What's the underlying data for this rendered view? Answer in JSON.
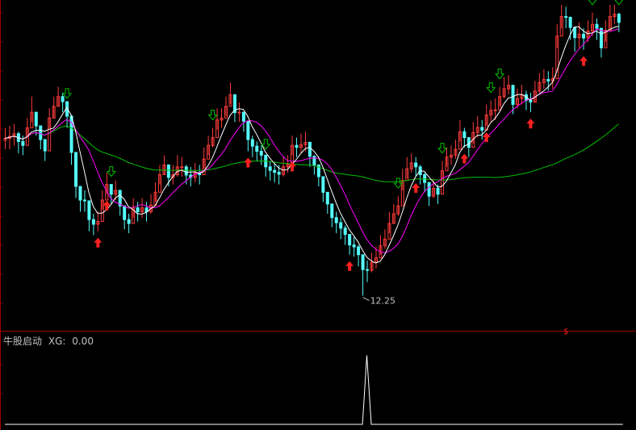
{
  "colors": {
    "up_candle": "#ff3b3b",
    "down_candle": "#54fcfc",
    "ma_short": "#ffffff",
    "ma_mid": "#ff00ff",
    "ma_long": "#00c000",
    "buy_arrow": "#ff2020",
    "sell_arrow": "#00c000",
    "axis": "#a00000",
    "grid_tick": "#800000",
    "indicator_line": "#ffffff"
  },
  "icons": {
    "buy": "red-up-arrow-icon",
    "sell": "green-down-arrow-icon"
  },
  "sub_panel": {
    "name": "牛股启动",
    "indicator": "XG:",
    "value": "0.00"
  },
  "chart_data": [
    {
      "type": "candlestick",
      "low_label": "12.25",
      "ylim": [
        11.6,
        19.7
      ],
      "closes": [
        16.28,
        16.33,
        16.4,
        16.2,
        16.1,
        16.55,
        16.95,
        16.6,
        16.25,
        15.96,
        16.8,
        17.1,
        17.35,
        17.22,
        16.85,
        15.92,
        15.05,
        14.7,
        14.68,
        14.2,
        14.08,
        14.15,
        14.7,
        15.1,
        14.85,
        14.95,
        14.55,
        14.2,
        14.1,
        14.5,
        14.4,
        14.5,
        14.4,
        14.57,
        14.9,
        15.35,
        15.6,
        15.28,
        15.35,
        15.55,
        15.55,
        15.34,
        15.28,
        15.4,
        15.35,
        15.75,
        16.1,
        16.3,
        16.75,
        16.8,
        17.1,
        17.4,
        16.94,
        16.95,
        16.72,
        16.25,
        16.08,
        15.95,
        15.85,
        15.55,
        15.46,
        15.41,
        15.36,
        15.55,
        15.62,
        16.1,
        16.05,
        16.12,
        16.18,
        15.82,
        15.6,
        15.3,
        14.9,
        14.6,
        14.25,
        14.12,
        13.98,
        13.82,
        13.55,
        13.5,
        13.3,
        12.92,
        12.9,
        13.1,
        13.22,
        13.53,
        13.7,
        14.1,
        14.35,
        14.55,
        15.2,
        15.5,
        15.65,
        15.55,
        15.35,
        15.15,
        14.8,
        15.0,
        14.85,
        15.45,
        15.8,
        15.85,
        16.0,
        16.45,
        16.3,
        16.05,
        16.43,
        16.56,
        16.49,
        16.88,
        17.0,
        17.01,
        17.35,
        17.55,
        17.64,
        17.15,
        17.3,
        17.4,
        17.25,
        17.21,
        17.49,
        17.71,
        17.79,
        17.75,
        17.81,
        18.9,
        19.4,
        19.38,
        19.12,
        18.86,
        18.95,
        18.85,
        19.03,
        19.2,
        19.1,
        18.6,
        19.05,
        19.4,
        19.46,
        19.25
      ],
      "lows": [
        16.0,
        16.0,
        16.1,
        15.9,
        15.85,
        16.3,
        16.7,
        16.35,
        16.0,
        15.7,
        16.5,
        16.8,
        17.1,
        16.95,
        16.55,
        15.6,
        14.75,
        14.4,
        14.4,
        13.9,
        13.8,
        13.9,
        14.45,
        14.85,
        14.6,
        14.7,
        14.3,
        13.95,
        13.85,
        14.25,
        14.15,
        14.25,
        14.15,
        14.35,
        14.65,
        15.1,
        15.35,
        15.05,
        15.1,
        15.3,
        15.3,
        15.1,
        15.05,
        15.15,
        15.1,
        15.5,
        15.85,
        16.05,
        16.5,
        16.55,
        16.85,
        17.15,
        16.7,
        16.7,
        16.45,
        15.95,
        15.8,
        15.7,
        15.6,
        15.3,
        15.2,
        15.15,
        15.1,
        15.3,
        15.4,
        15.85,
        15.8,
        15.9,
        15.95,
        15.55,
        15.35,
        15.05,
        14.65,
        14.35,
        14.0,
        13.85,
        13.7,
        13.55,
        13.3,
        13.25,
        13.0,
        12.25,
        12.6,
        12.85,
        12.95,
        13.3,
        13.45,
        13.85,
        14.1,
        14.3,
        14.95,
        15.25,
        15.4,
        15.3,
        15.1,
        14.9,
        14.55,
        14.75,
        14.6,
        15.2,
        15.55,
        15.6,
        15.75,
        16.2,
        16.05,
        15.8,
        16.15,
        16.3,
        16.25,
        16.6,
        16.7,
        16.75,
        17.1,
        17.3,
        17.4,
        16.9,
        17.05,
        17.15,
        17.0,
        16.95,
        17.2,
        17.45,
        17.55,
        17.5,
        17.55,
        18.6,
        19.1,
        19.1,
        18.8,
        18.5,
        18.6,
        18.55,
        18.75,
        18.9,
        18.8,
        18.35,
        18.75,
        19.1,
        19.2,
        19.0
      ],
      "highs": [
        16.55,
        16.6,
        16.65,
        16.45,
        16.35,
        16.8,
        17.35,
        16.85,
        16.5,
        16.2,
        17.05,
        17.35,
        17.6,
        17.45,
        17.1,
        16.2,
        15.35,
        14.95,
        14.95,
        14.45,
        14.35,
        14.4,
        14.95,
        15.4,
        15.1,
        15.2,
        14.8,
        14.45,
        14.35,
        14.75,
        14.65,
        14.75,
        14.65,
        14.85,
        15.15,
        15.6,
        15.85,
        15.55,
        15.6,
        15.85,
        15.8,
        15.6,
        15.55,
        15.65,
        15.6,
        16.05,
        16.35,
        16.55,
        17.05,
        17.05,
        17.35,
        17.7,
        17.2,
        17.2,
        16.95,
        16.5,
        16.35,
        16.2,
        16.1,
        15.8,
        15.7,
        15.65,
        15.6,
        15.8,
        15.85,
        16.35,
        16.3,
        16.4,
        16.45,
        16.1,
        15.85,
        15.55,
        15.15,
        14.85,
        14.5,
        14.4,
        14.25,
        14.05,
        13.8,
        13.75,
        13.55,
        13.2,
        13.15,
        13.35,
        13.5,
        13.8,
        13.95,
        14.4,
        14.6,
        14.8,
        15.5,
        15.8,
        15.9,
        15.8,
        15.6,
        15.4,
        15.05,
        15.25,
        15.1,
        15.7,
        16.05,
        16.1,
        16.25,
        16.75,
        16.55,
        16.3,
        16.7,
        16.85,
        16.75,
        17.15,
        17.25,
        17.3,
        17.6,
        17.85,
        17.9,
        17.4,
        17.55,
        17.65,
        17.5,
        17.45,
        17.75,
        17.95,
        18.05,
        18.0,
        18.1,
        19.2,
        19.7,
        19.65,
        19.4,
        19.1,
        19.25,
        19.1,
        19.3,
        19.5,
        19.35,
        18.85,
        19.3,
        19.7,
        19.7,
        19.5
      ],
      "buy_signals": [
        21,
        23,
        55,
        65,
        78,
        93,
        104,
        109,
        119,
        131
      ],
      "sell_signals": [
        14,
        24,
        47,
        59,
        89,
        99,
        110,
        112,
        133,
        139
      ],
      "moving_averages": [
        {
          "period": 5
        },
        {
          "period": 10
        },
        {
          "period": 60
        }
      ]
    },
    {
      "type": "line",
      "name": "XG",
      "values": [
        0,
        0,
        0,
        0,
        0,
        0,
        0,
        0,
        0,
        0,
        0,
        0,
        0,
        0,
        0,
        0,
        0,
        0,
        0,
        0,
        0,
        0,
        0,
        0,
        0,
        0,
        0,
        0,
        0,
        0,
        0,
        0,
        0,
        0,
        0,
        0,
        0,
        0,
        0,
        0,
        0,
        0,
        0,
        0,
        0,
        0,
        0,
        0,
        0,
        0,
        0,
        0,
        0,
        0,
        0,
        0,
        0,
        0,
        0,
        0,
        0,
        0,
        0,
        0,
        0,
        0,
        0,
        0,
        0,
        0,
        0,
        0,
        0,
        0,
        0,
        0,
        0,
        0,
        0,
        0,
        0,
        0,
        1,
        0,
        0,
        0,
        0,
        0,
        0,
        0,
        0,
        0,
        0,
        0,
        0,
        0,
        0,
        0,
        0,
        0,
        0,
        0,
        0,
        0,
        0,
        0,
        0,
        0,
        0,
        0,
        0,
        0,
        0,
        0,
        0,
        0,
        0,
        0,
        0,
        0,
        0,
        0,
        0,
        0,
        0,
        0,
        0,
        0,
        0,
        0,
        0,
        0,
        0,
        0,
        0,
        0,
        0,
        0,
        0,
        0,
        0
      ],
      "ylim": [
        0,
        1.1
      ]
    }
  ]
}
